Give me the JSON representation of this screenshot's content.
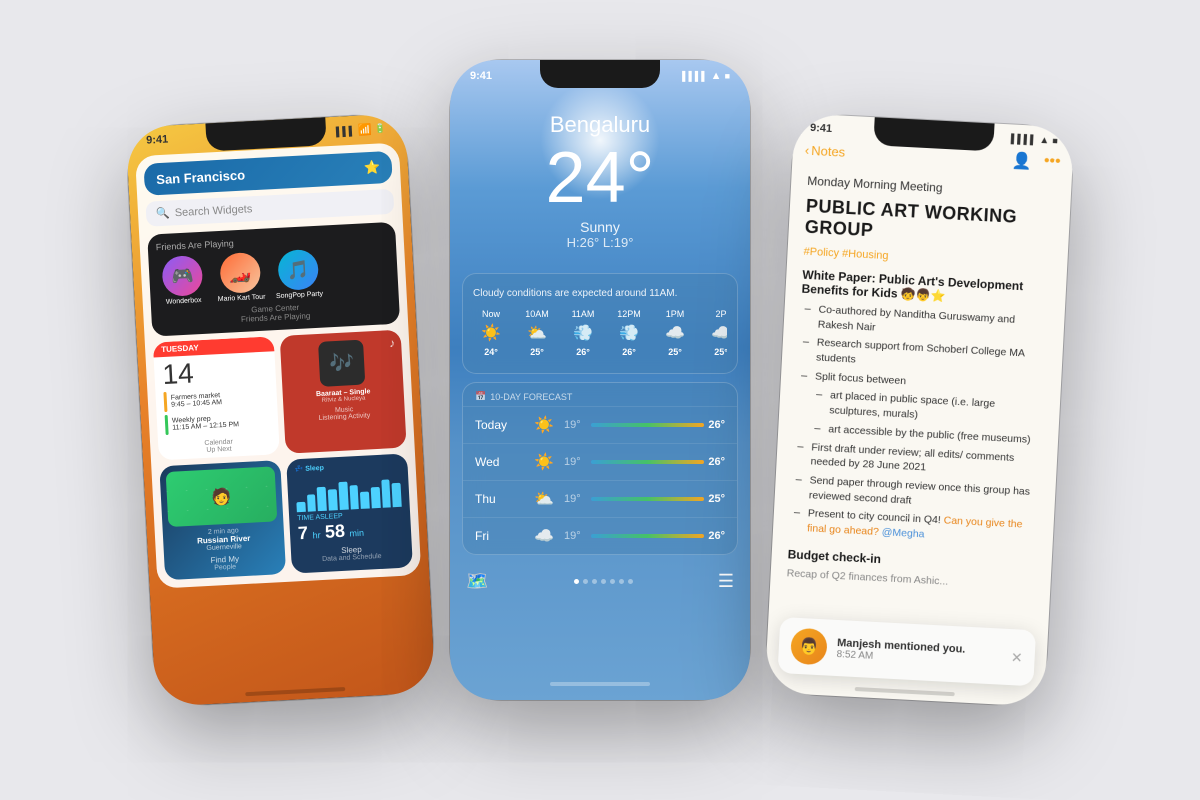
{
  "phone1": {
    "status": {
      "time": "9:41",
      "signal": "●●●",
      "wifi": "wifi",
      "battery": "100%"
    },
    "location": "San Francisco",
    "search": {
      "placeholder": "Search Widgets"
    },
    "gamecenter": {
      "title": "Friends Are Playing",
      "games": [
        {
          "name": "Wonderbox",
          "emoji": "🎮"
        },
        {
          "name": "Mario Kart Tour",
          "emoji": "🏎️"
        },
        {
          "name": "SongPop Party",
          "emoji": "🎵"
        }
      ],
      "label": "Game Center",
      "sublabel": "Friends Are Playing"
    },
    "calendar": {
      "day": "TUESDAY",
      "date": "14",
      "events": [
        {
          "color": "#f5a623",
          "text": "Farmers market\n9:45 – 10:45 AM"
        },
        {
          "color": "#34c759",
          "text": "Weekly prep\n11:15 AM – 12:15 PM"
        }
      ],
      "label": "Calendar",
      "sublabel": "Up Next"
    },
    "music": {
      "title": "Baaraat – Single",
      "artist": "Ritviz & Nucleya",
      "label": "Music",
      "sublabel": "Listening Activity"
    },
    "findmy": {
      "time_ago": "2 min ago",
      "location": "Russian River",
      "sublocation": "Guerneville",
      "label": "Find My",
      "sublabel": "People"
    },
    "sleep": {
      "header": "💤 Sleep",
      "label": "TIME ASLEEP",
      "hours": "7",
      "mins": "58",
      "unit": "min",
      "label2": "Sleep",
      "sublabel": "Data and Schedule",
      "bars": [
        3,
        5,
        7,
        6,
        8,
        7,
        5,
        6,
        8,
        7
      ]
    }
  },
  "phone2": {
    "status": {
      "time": "9:41",
      "bars": 4,
      "wifi": true,
      "battery": 100
    },
    "city": "Bengaluru",
    "temp": "24°",
    "condition": "Sunny",
    "high": "H:26°",
    "low": "L:19°",
    "alert": "Cloudy conditions are expected around 11AM.",
    "hourly": [
      {
        "time": "Now",
        "icon": "☀️",
        "temp": "24°"
      },
      {
        "time": "10AM",
        "icon": "⛅",
        "temp": "25°"
      },
      {
        "time": "11AM",
        "icon": "💨",
        "temp": "26°"
      },
      {
        "time": "12PM",
        "icon": "💨",
        "temp": "26°"
      },
      {
        "time": "1PM",
        "icon": "☁️",
        "temp": "25°"
      },
      {
        "time": "2P",
        "icon": "☁️",
        "temp": "25°"
      }
    ],
    "forecast_header": "📅 10-DAY FORECAST",
    "forecast": [
      {
        "day": "Today",
        "icon": "☀️",
        "low": "19°",
        "high": "26°",
        "bar_color": "#f5a623"
      },
      {
        "day": "Wed",
        "icon": "☀️",
        "low": "19°",
        "high": "26°",
        "bar_color": "#f5a623"
      },
      {
        "day": "Thu",
        "icon": "⛅",
        "low": "19°",
        "high": "25°",
        "bar_color": "#e8851a"
      },
      {
        "day": "Fri",
        "icon": "☁️",
        "low": "19°",
        "high": "26°",
        "bar_color": "#d4d4d4"
      }
    ]
  },
  "phone3": {
    "status": {
      "time": "9:41",
      "bars": 4,
      "wifi": true,
      "battery": 100
    },
    "nav": {
      "back_label": "Notes",
      "share_icon": "👤",
      "more_icon": "•••"
    },
    "note": {
      "title": "Monday Morning Meeting",
      "heading": "PUBLIC ART WORKING GROUP",
      "tags": "#Policy #Housing",
      "section1": "White Paper: Public Art's Development Benefits for Kids 🧒👦⭐",
      "bullets": [
        "Co-authored by Nanditha Guruswamy and Rakesh Nair",
        "Research support from Schoberl College MA students",
        "Split focus between",
        "art placed in public space (i.e. large sculptures, murals)",
        "art accessible by the public (free museums)",
        "First draft under review; all edits/ comments needed by 28 June 2021",
        "Send paper through review once this group has reviewed second draft",
        "Present to city council in Q4!"
      ],
      "highlight_text": "Can you give the final go ahead?",
      "mention": "@Megha",
      "section2": "Budget check-in",
      "section2_sub": "Recap of Q2 finances from Ashic..."
    },
    "notification": {
      "name": "Manjesh",
      "action": "mentioned you.",
      "time": "8:52 AM",
      "emoji": "👨"
    }
  }
}
